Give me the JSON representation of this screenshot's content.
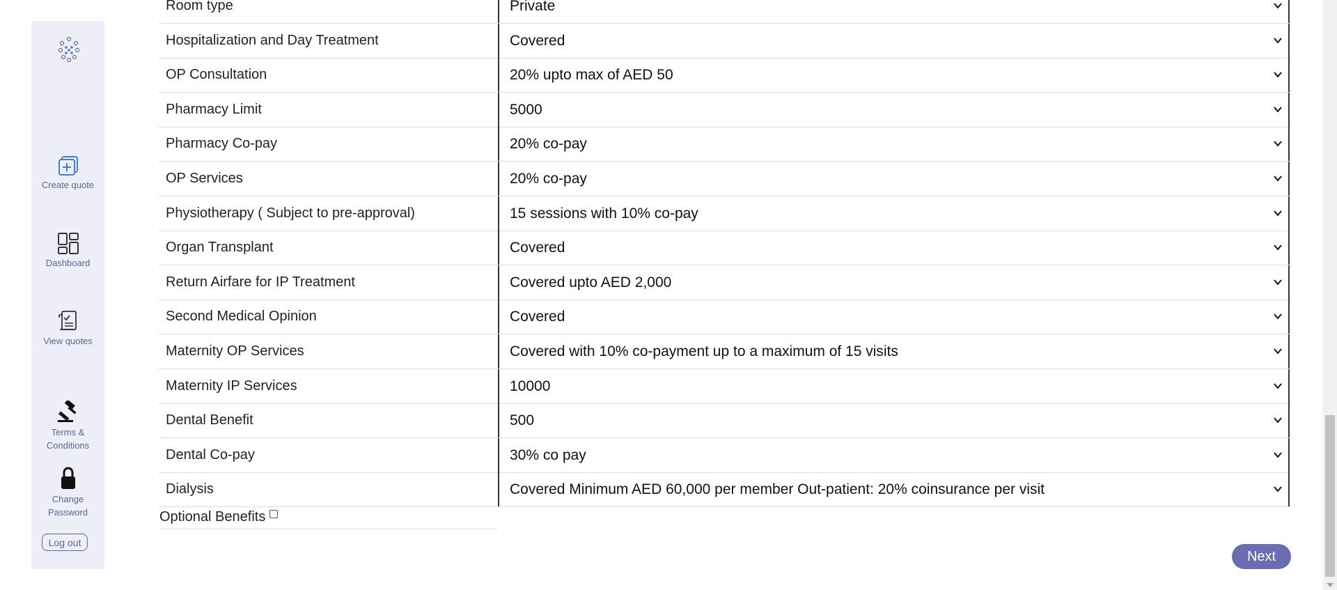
{
  "sidebar": {
    "logo_icon": "dots-flower-logo",
    "items": [
      {
        "label": "Create quote",
        "icon": "plus-square-icon"
      },
      {
        "label": "Dashboard",
        "icon": "dashboard-grid-icon"
      },
      {
        "label": "View quotes",
        "icon": "document-check-icon"
      },
      {
        "label_line1": "Terms &",
        "label_line2": "Conditions",
        "icon": "gavel-icon"
      },
      {
        "label_line1": "Change",
        "label_line2": "Password",
        "icon": "lock-icon"
      }
    ],
    "logout_label": "Log out",
    "accent_color": "#5b6694"
  },
  "benefits": [
    {
      "label": "Room type",
      "value": "Private"
    },
    {
      "label": "Hospitalization and Day Treatment",
      "value": "Covered"
    },
    {
      "label": "OP Consultation",
      "value": "20% upto max of AED 50"
    },
    {
      "label": "Pharmacy Limit",
      "value": "5000"
    },
    {
      "label": "Pharmacy Co-pay",
      "value": "20% co-pay"
    },
    {
      "label": "OP Services",
      "value": "20% co-pay"
    },
    {
      "label": "Physiotherapy ( Subject to pre-approval)",
      "value": "15 sessions with 10% co-pay"
    },
    {
      "label": "Organ Transplant",
      "value": "Covered"
    },
    {
      "label": "Return Airfare for IP Treatment",
      "value": "Covered upto AED 2,000"
    },
    {
      "label": "Second Medical Opinion",
      "value": "Covered"
    },
    {
      "label": "Maternity OP Services",
      "value": "Covered with 10% co-payment up to a maximum of 15 visits"
    },
    {
      "label": "Maternity IP Services",
      "value": "10000"
    },
    {
      "label": "Dental Benefit",
      "value": "500"
    },
    {
      "label": "Dental Co-pay",
      "value": "30% co pay"
    },
    {
      "label": "Dialysis",
      "value": "Covered Minimum AED 60,000 per member Out-patient: 20% coinsurance per visit"
    }
  ],
  "optional_benefits": {
    "label": "Optional Benefits",
    "checked": false
  },
  "next_button": {
    "label": "Next",
    "color": "#6b6db3"
  }
}
